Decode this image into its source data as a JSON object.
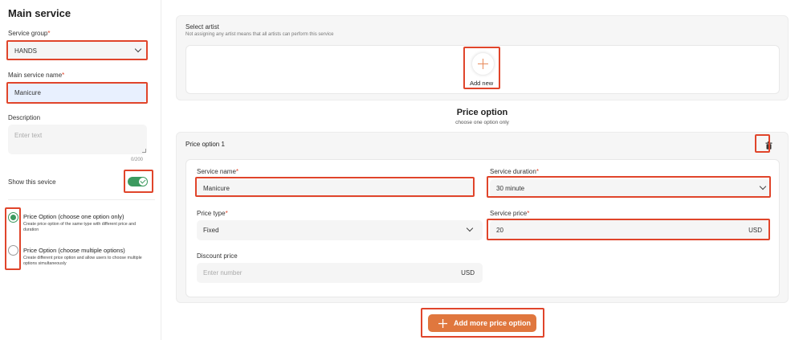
{
  "left": {
    "title": "Main service",
    "service_group_label": "Service group",
    "service_group_value": "HANDS",
    "main_service_name_label": "Main service name",
    "main_service_name_value": "Manicure",
    "description_label": "Description",
    "description_placeholder": "Enter text",
    "description_counter": "0/200",
    "show_service_label": "Show this sevice",
    "options": [
      {
        "title": "Price Option (choose one option only)",
        "desc": "Create price option of the same type with different price and duration",
        "selected": true
      },
      {
        "title": "Price Option (choose multiple options)",
        "desc": "Create different price option and allow users to choose multiple options simultaneously",
        "selected": false
      }
    ]
  },
  "artist": {
    "label": "Select artist",
    "note": "Not assigning any artist means that all artists can perform this service",
    "add_new": "Add new"
  },
  "price_header": {
    "title": "Price option",
    "subtitle": "choose one option only"
  },
  "price_option": {
    "title": "Price option 1",
    "service_name_label": "Service name",
    "service_name_value": "Manicure",
    "duration_label": "Service duration",
    "duration_value": "30 minute",
    "price_type_label": "Price type",
    "price_type_value": "Fixed",
    "service_price_label": "Service price",
    "service_price_value": "20",
    "currency": "USD",
    "discount_label": "Discount price",
    "discount_placeholder": "Enter number",
    "discount_currency": "USD"
  },
  "add_more_button": "Add more price option",
  "colors": {
    "accent": "#e0773e",
    "highlight": "#e0452b",
    "green": "#3c9a5f"
  }
}
